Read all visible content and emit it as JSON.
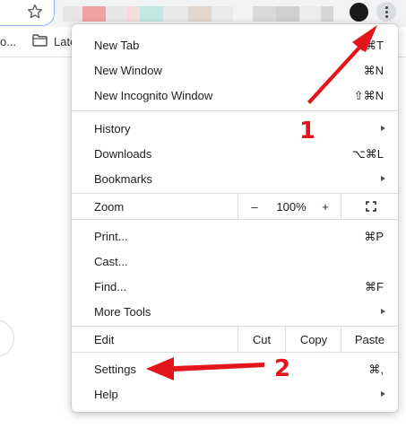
{
  "browser": {
    "bookmark_partial": "o...",
    "bookmark_folder_label": "Late",
    "extension_colors": [
      "#e6e6e6",
      "#f0a0a0",
      "#e6e6e6",
      "#f5dcdc",
      "#bfe9e0",
      "#e8e8e8",
      "#e3d6cc",
      "#eaeaea",
      "#f3f3f3",
      "#d9d9d9",
      "#cfcfcf",
      "#ececec",
      "#d6d6d6"
    ]
  },
  "menu": {
    "new_tab": {
      "label": "New Tab",
      "shortcut": "⌘T"
    },
    "new_window": {
      "label": "New Window",
      "shortcut": "⌘N"
    },
    "new_incognito": {
      "label": "New Incognito Window",
      "shortcut": "⇧⌘N"
    },
    "history": {
      "label": "History"
    },
    "downloads": {
      "label": "Downloads",
      "shortcut": "⌥⌘L"
    },
    "bookmarks": {
      "label": "Bookmarks"
    },
    "zoom": {
      "label": "Zoom",
      "minus": "–",
      "value": "100%",
      "plus": "+"
    },
    "print": {
      "label": "Print...",
      "shortcut": "⌘P"
    },
    "cast": {
      "label": "Cast..."
    },
    "find": {
      "label": "Find...",
      "shortcut": "⌘F"
    },
    "more_tools": {
      "label": "More Tools"
    },
    "edit": {
      "label": "Edit",
      "cut": "Cut",
      "copy": "Copy",
      "paste": "Paste"
    },
    "settings": {
      "label": "Settings",
      "shortcut": "⌘,"
    },
    "help": {
      "label": "Help"
    }
  },
  "annotations": {
    "step1": "1",
    "step2": "2",
    "arrow_color": "#e3141b"
  },
  "icons": {
    "star": "star-icon",
    "folder": "folder-icon",
    "kebab": "kebab-menu-icon",
    "fullscreen": "fullscreen-icon"
  }
}
